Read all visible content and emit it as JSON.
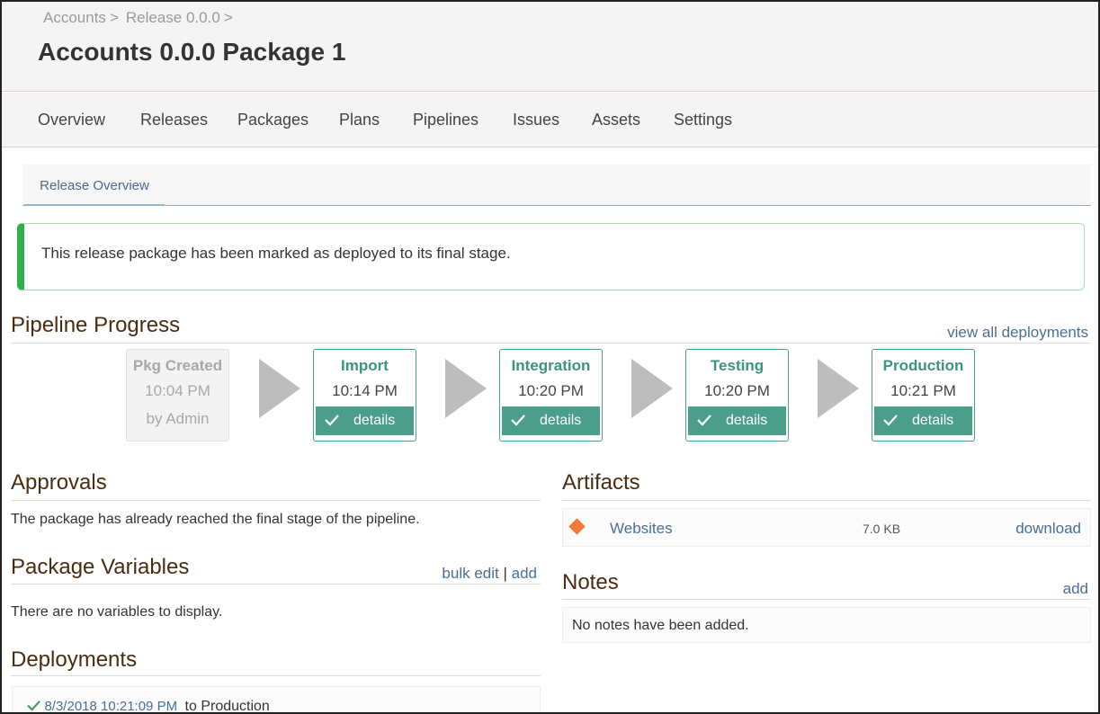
{
  "breadcrumb": [
    {
      "label": "Accounts"
    },
    {
      "label": "Release 0.0.0"
    }
  ],
  "breadcrumb_sep": ">",
  "page_title": "Accounts 0.0.0 Package 1",
  "nav": [
    "Overview",
    "Releases",
    "Packages",
    "Plans",
    "Pipelines",
    "Issues",
    "Assets",
    "Settings"
  ],
  "subtab": "Release Overview",
  "alert": "This release package has been marked as deployed to its final stage.",
  "pipeline": {
    "title": "Pipeline Progress",
    "view_all": "view all deployments",
    "pkg_created": {
      "name": "Pkg Created",
      "time": "10:04 PM",
      "by": "by Admin"
    },
    "stages": [
      {
        "name": "Import",
        "time": "10:14 PM",
        "details": "details"
      },
      {
        "name": "Integration",
        "time": "10:20 PM",
        "details": "details"
      },
      {
        "name": "Testing",
        "time": "10:20 PM",
        "details": "details"
      },
      {
        "name": "Production",
        "time": "10:21 PM",
        "details": "details"
      }
    ]
  },
  "approvals": {
    "title": "Approvals",
    "text": "The package has already reached the final stage of the pipeline."
  },
  "variables": {
    "title": "Package Variables",
    "bulk_edit": "bulk edit",
    "separator": "|",
    "add": "add",
    "text": "There are no variables to display."
  },
  "deployments": {
    "title": "Deployments",
    "items": [
      {
        "timestamp": "8/3/2018 10:21:09 PM",
        "target": "to Production"
      }
    ]
  },
  "artifacts": {
    "title": "Artifacts",
    "items": [
      {
        "name": "Websites",
        "size": "7.0 KB",
        "action": "download"
      }
    ]
  },
  "notes": {
    "title": "Notes",
    "add": "add",
    "text": "No notes have been added."
  },
  "colors": {
    "accent": "#4a9e8a",
    "link": "#4a6f96",
    "section_title": "#4a2c10",
    "success_border": "#2fb04a",
    "artifact_icon": "#f07a3c"
  }
}
